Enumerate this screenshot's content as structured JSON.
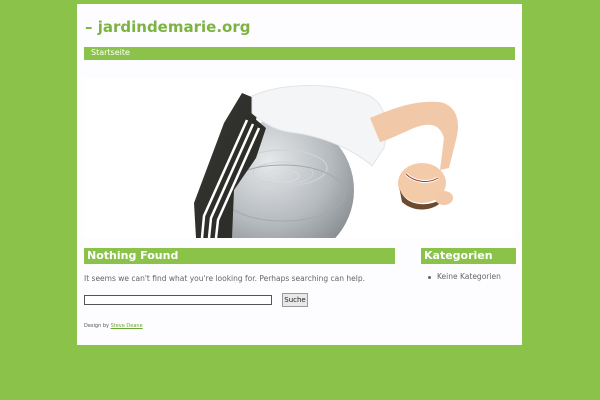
{
  "site": {
    "title": "– jardindemarie.org"
  },
  "nav": {
    "items": [
      {
        "label": "Startseite"
      }
    ]
  },
  "main": {
    "heading": "Nothing Found",
    "message": "It seems we can't find what you're looking for. Perhaps searching can help.",
    "search": {
      "value": "",
      "button_label": "Suche"
    },
    "credit": {
      "prefix": "Design by",
      "link_text": "Steve Deane"
    }
  },
  "sidebar": {
    "heading": "Kategorien",
    "items": [
      {
        "label": "Keine Kategorien"
      }
    ]
  },
  "colors": {
    "page_background": "#8bc34a",
    "accent": "#8bc34a",
    "title": "#7cb342",
    "content_background": "#fdfcfe"
  },
  "header_image": {
    "subject": "person-on-exercise-ball-photo"
  }
}
